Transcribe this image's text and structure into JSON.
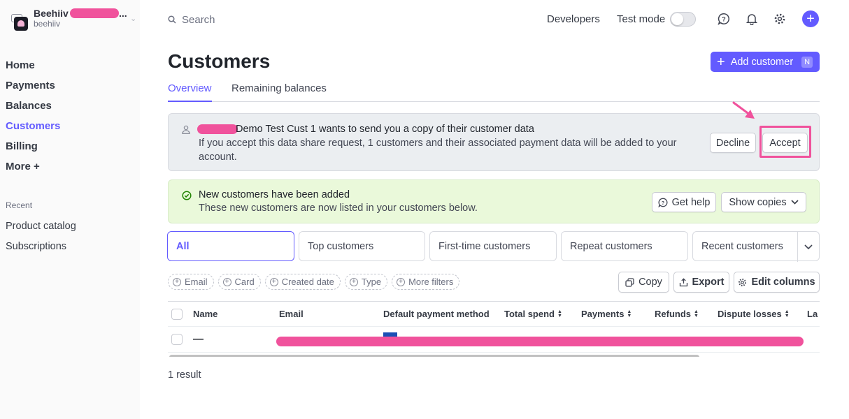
{
  "account": {
    "name": "Beehiiv",
    "ellipsis": "...",
    "sub": "beehiiv"
  },
  "sidebar": {
    "items": [
      {
        "label": "Home"
      },
      {
        "label": "Payments"
      },
      {
        "label": "Balances"
      },
      {
        "label": "Customers",
        "active": true
      },
      {
        "label": "Billing"
      },
      {
        "label": "More +"
      }
    ],
    "recent_heading": "Recent",
    "recent": [
      {
        "label": "Product catalog"
      },
      {
        "label": "Subscriptions"
      }
    ]
  },
  "topbar": {
    "search_placeholder": "Search",
    "developers": "Developers",
    "test_mode": "Test mode",
    "icons": [
      "help-icon",
      "bell-icon",
      "gear-icon",
      "plus-icon"
    ]
  },
  "page": {
    "title": "Customers",
    "add_button": "Add customer",
    "add_shortcut": "N",
    "tabs": [
      {
        "label": "Overview",
        "active": true
      },
      {
        "label": "Remaining balances"
      }
    ]
  },
  "share_banner": {
    "title": "Demo Test Cust 1 wants to send you a copy of their customer data",
    "description": "If you accept this data share request, 1 customers and their associated payment data will be added to your account.",
    "decline": "Decline",
    "accept": "Accept"
  },
  "success_banner": {
    "title": "New customers have been added",
    "description": "These new customers are now listed in your customers below.",
    "get_help": "Get help",
    "show_copies": "Show copies"
  },
  "segments": [
    {
      "label": "All",
      "active": true
    },
    {
      "label": "Top customers"
    },
    {
      "label": "First-time customers"
    },
    {
      "label": "Repeat customers"
    },
    {
      "label": "Recent customers"
    }
  ],
  "filters": [
    "Email",
    "Card",
    "Created date",
    "Type",
    "More filters"
  ],
  "actions": {
    "copy": "Copy",
    "export": "Export",
    "edit_columns": "Edit columns"
  },
  "table": {
    "columns": [
      "Name",
      "Email",
      "Default payment method",
      "Total spend",
      "Payments",
      "Refunds",
      "Dispute losses",
      "La"
    ],
    "rows": [
      {
        "name": "—"
      }
    ]
  },
  "result_count": "1 result",
  "colors": {
    "accent": "#635bff",
    "highlight": "#f0529c",
    "success_bg": "#eaf9da"
  }
}
